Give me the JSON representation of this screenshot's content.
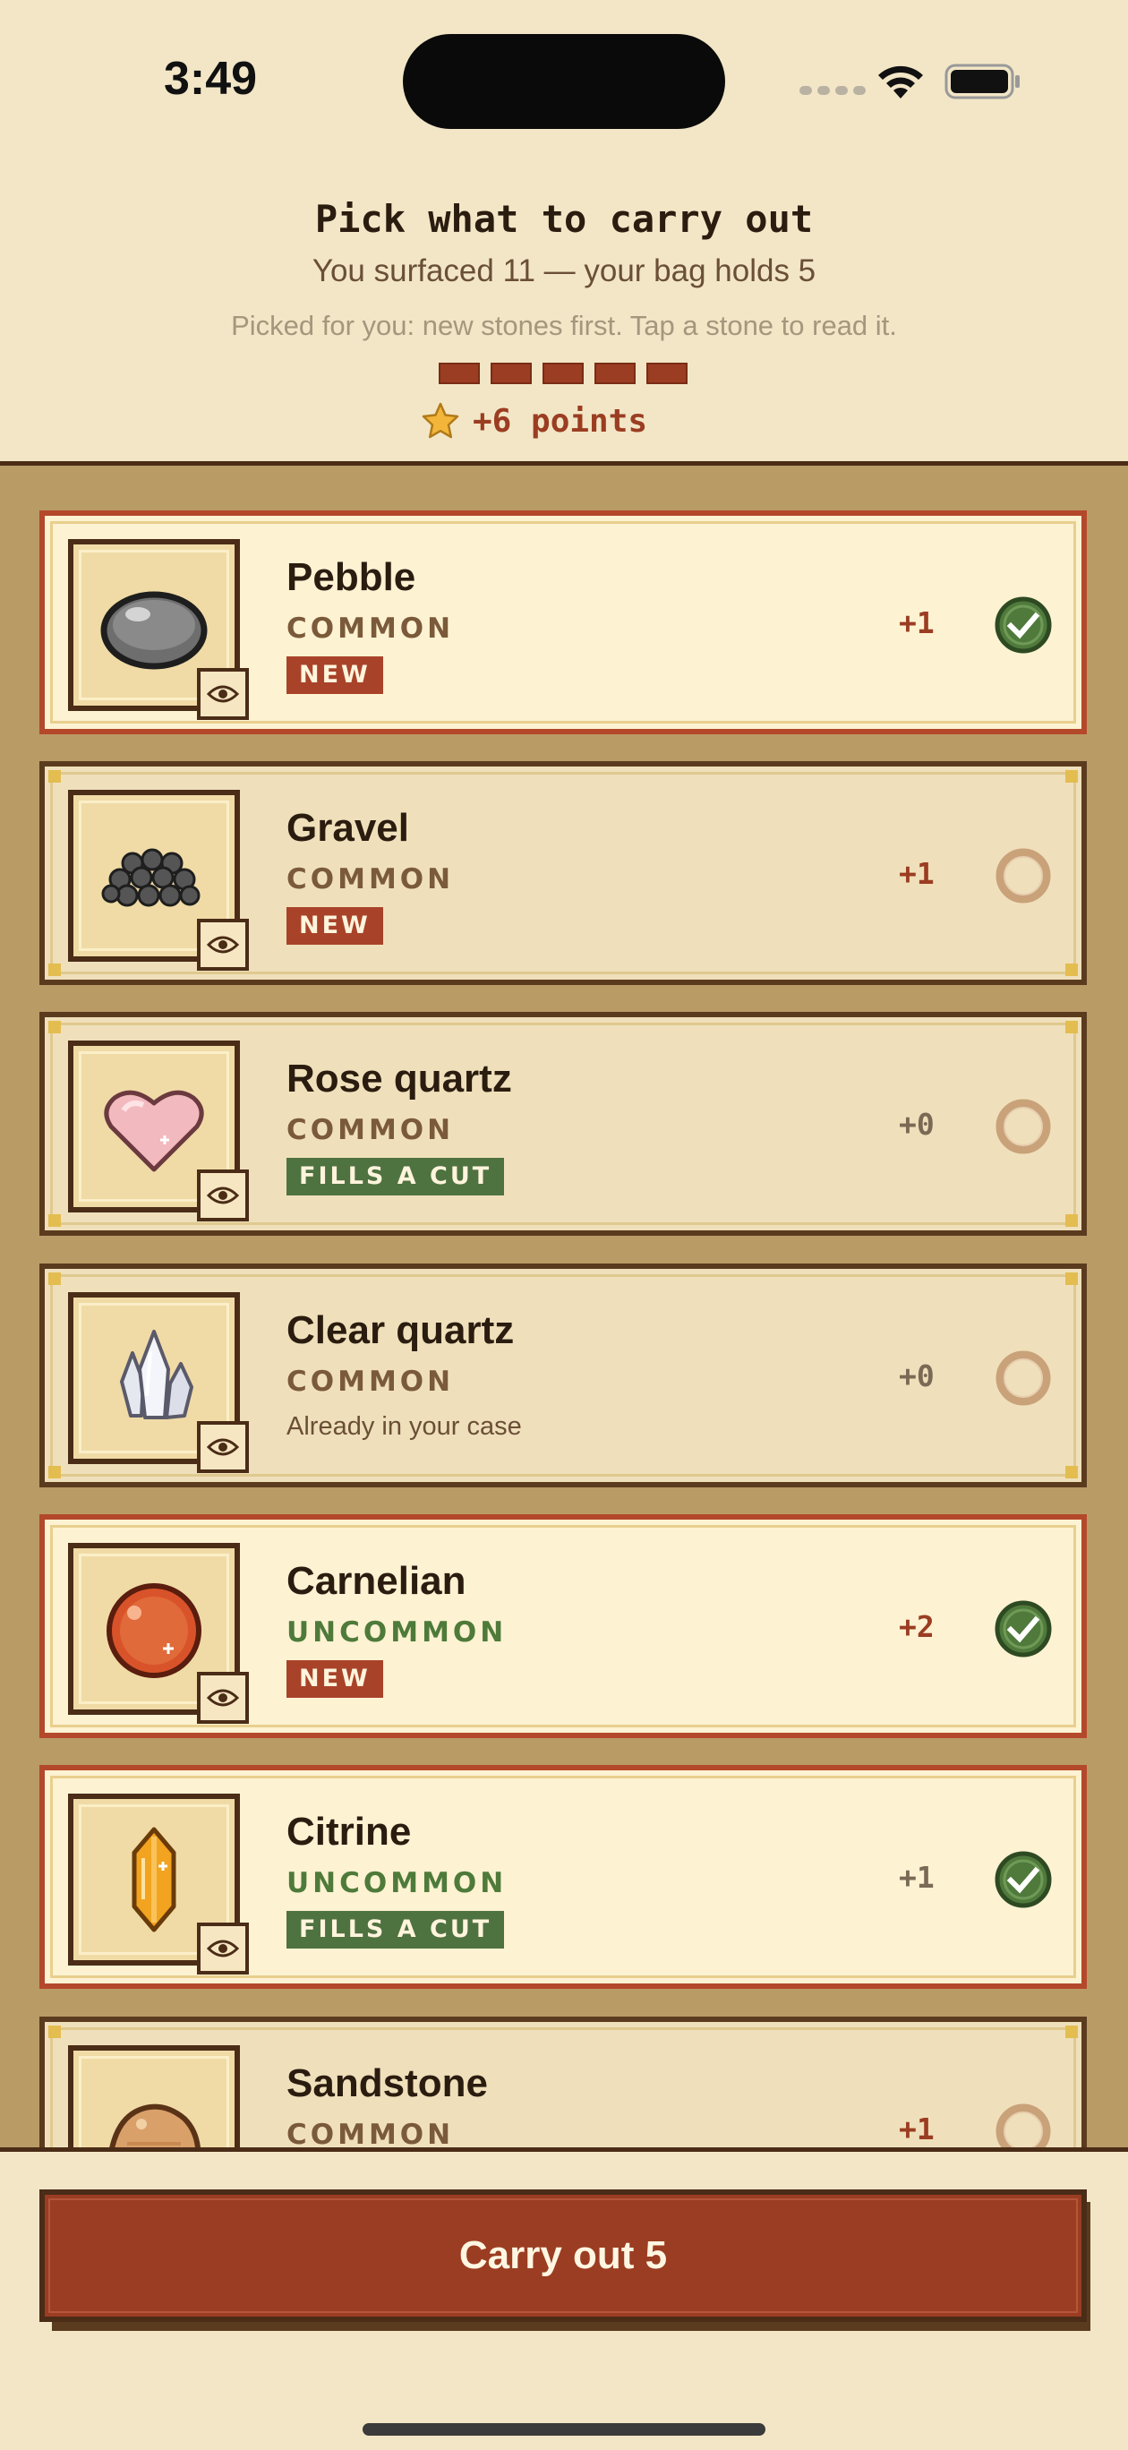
{
  "status_bar": {
    "time": "3:49"
  },
  "header": {
    "title": "Pick what to carry out",
    "subtitle": "You surfaced 11 — your bag holds 5",
    "hint": "Picked for you: new stones first. Tap a stone to read it.",
    "bag_slots_filled": 5,
    "bag_slots_total": 5,
    "points_label": "+6 points"
  },
  "stones": [
    {
      "name": "Pebble",
      "rarity": "COMMON",
      "tag": "NEW",
      "points": "+1",
      "selected": true,
      "icon": "pebble-icon"
    },
    {
      "name": "Gravel",
      "rarity": "COMMON",
      "tag": "NEW",
      "points": "+1",
      "selected": false,
      "icon": "gravel-icon"
    },
    {
      "name": "Rose quartz",
      "rarity": "COMMON",
      "tag": "FILLS A CUT",
      "points": "+0",
      "selected": false,
      "icon": "rose-quartz-icon"
    },
    {
      "name": "Clear quartz",
      "rarity": "COMMON",
      "note": "Already in your case",
      "points": "+0",
      "selected": false,
      "icon": "clear-quartz-icon"
    },
    {
      "name": "Carnelian",
      "rarity": "UNCOMMON",
      "tag": "NEW",
      "points": "+2",
      "selected": true,
      "icon": "carnelian-icon"
    },
    {
      "name": "Citrine",
      "rarity": "UNCOMMON",
      "tag": "FILLS A CUT",
      "points": "+1",
      "selected": true,
      "icon": "citrine-icon"
    },
    {
      "name": "Sandstone",
      "rarity": "COMMON",
      "points": "+1",
      "selected": false,
      "icon": "sandstone-icon"
    }
  ],
  "footer": {
    "button_label": "Carry out 5"
  },
  "colors": {
    "accent": "#9b3d22",
    "selected_border": "#b4482a",
    "check_green": "#4f7a3c",
    "background": "#f2e6c6",
    "list_bg": "#b99b66"
  }
}
